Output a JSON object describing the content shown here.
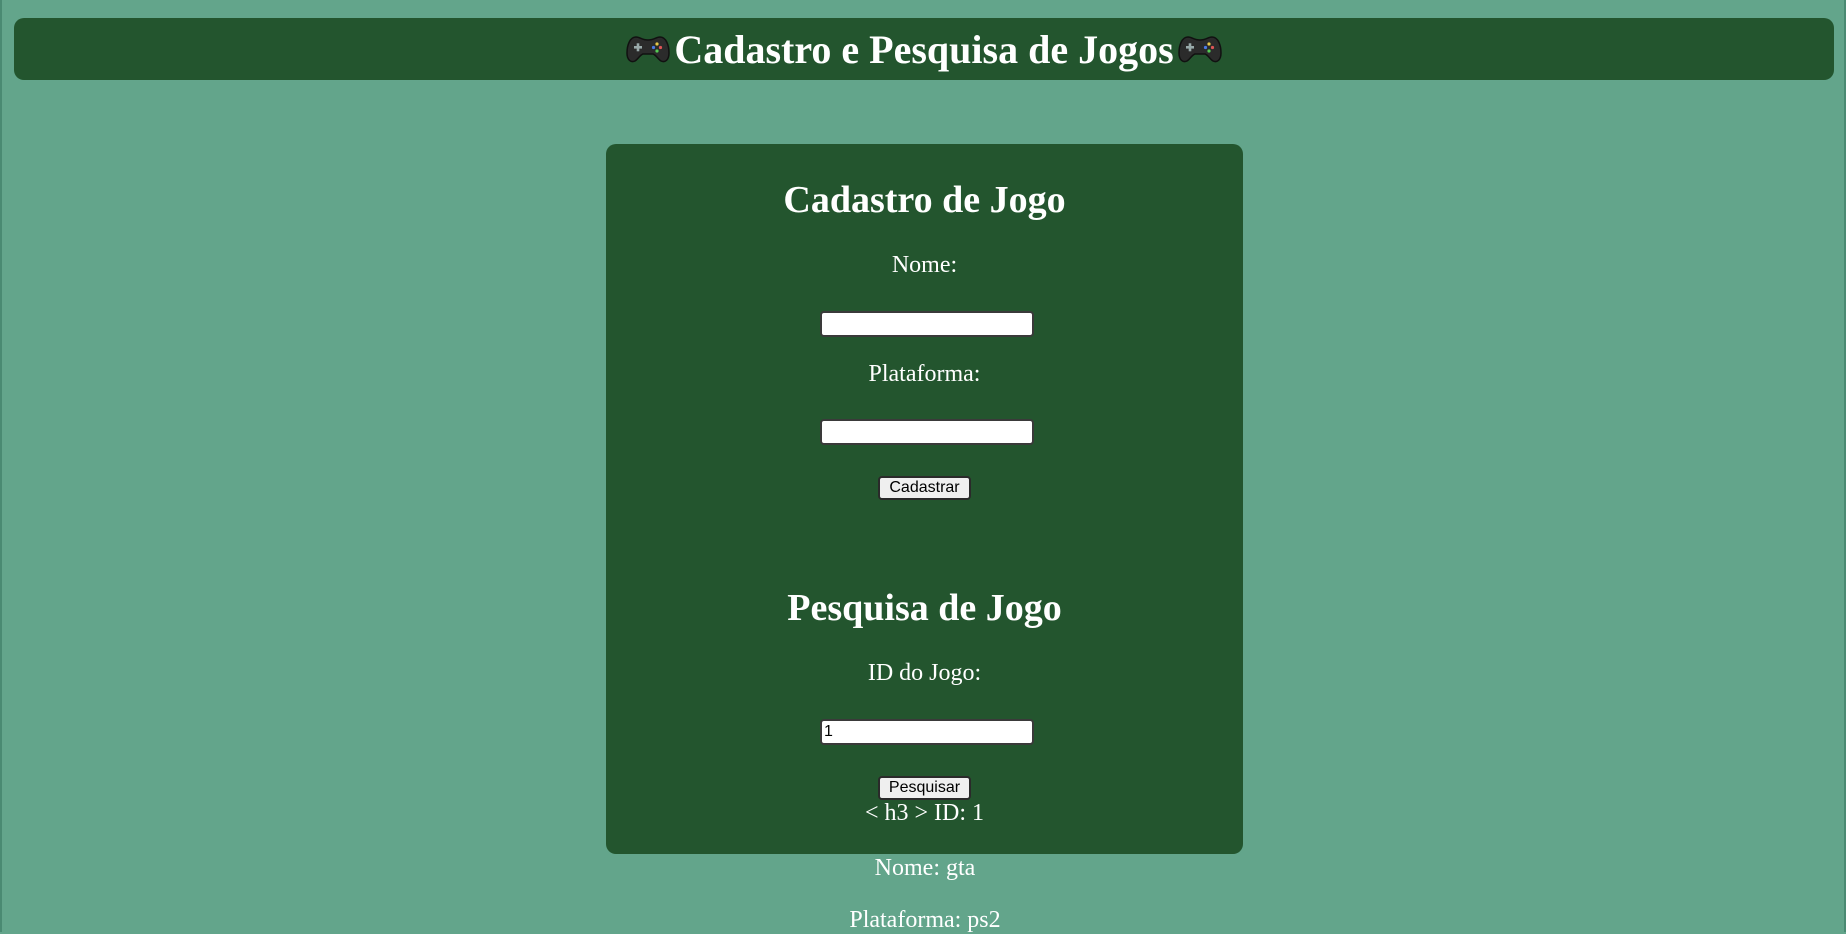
{
  "header": {
    "title": "Cadastro e Pesquisa de Jogos",
    "left_icon": "gamepad-icon",
    "right_icon": "gamepad-icon"
  },
  "register": {
    "title": "Cadastro de Jogo",
    "name_label": "Nome:",
    "name_value": "",
    "platform_label": "Plataforma:",
    "platform_value": "",
    "submit_label": "Cadastrar"
  },
  "search": {
    "title": "Pesquisa de Jogo",
    "id_label": "ID do Jogo:",
    "id_value": "1",
    "submit_label": "Pesquisar"
  },
  "result": {
    "id_line": "< h3 > ID: 1",
    "name_line": "Nome: gta",
    "platform_line": "Plataforma: ps2"
  },
  "colors": {
    "page_background": "#63a58b",
    "panel_background": "#23552e",
    "text": "#ffffff"
  }
}
